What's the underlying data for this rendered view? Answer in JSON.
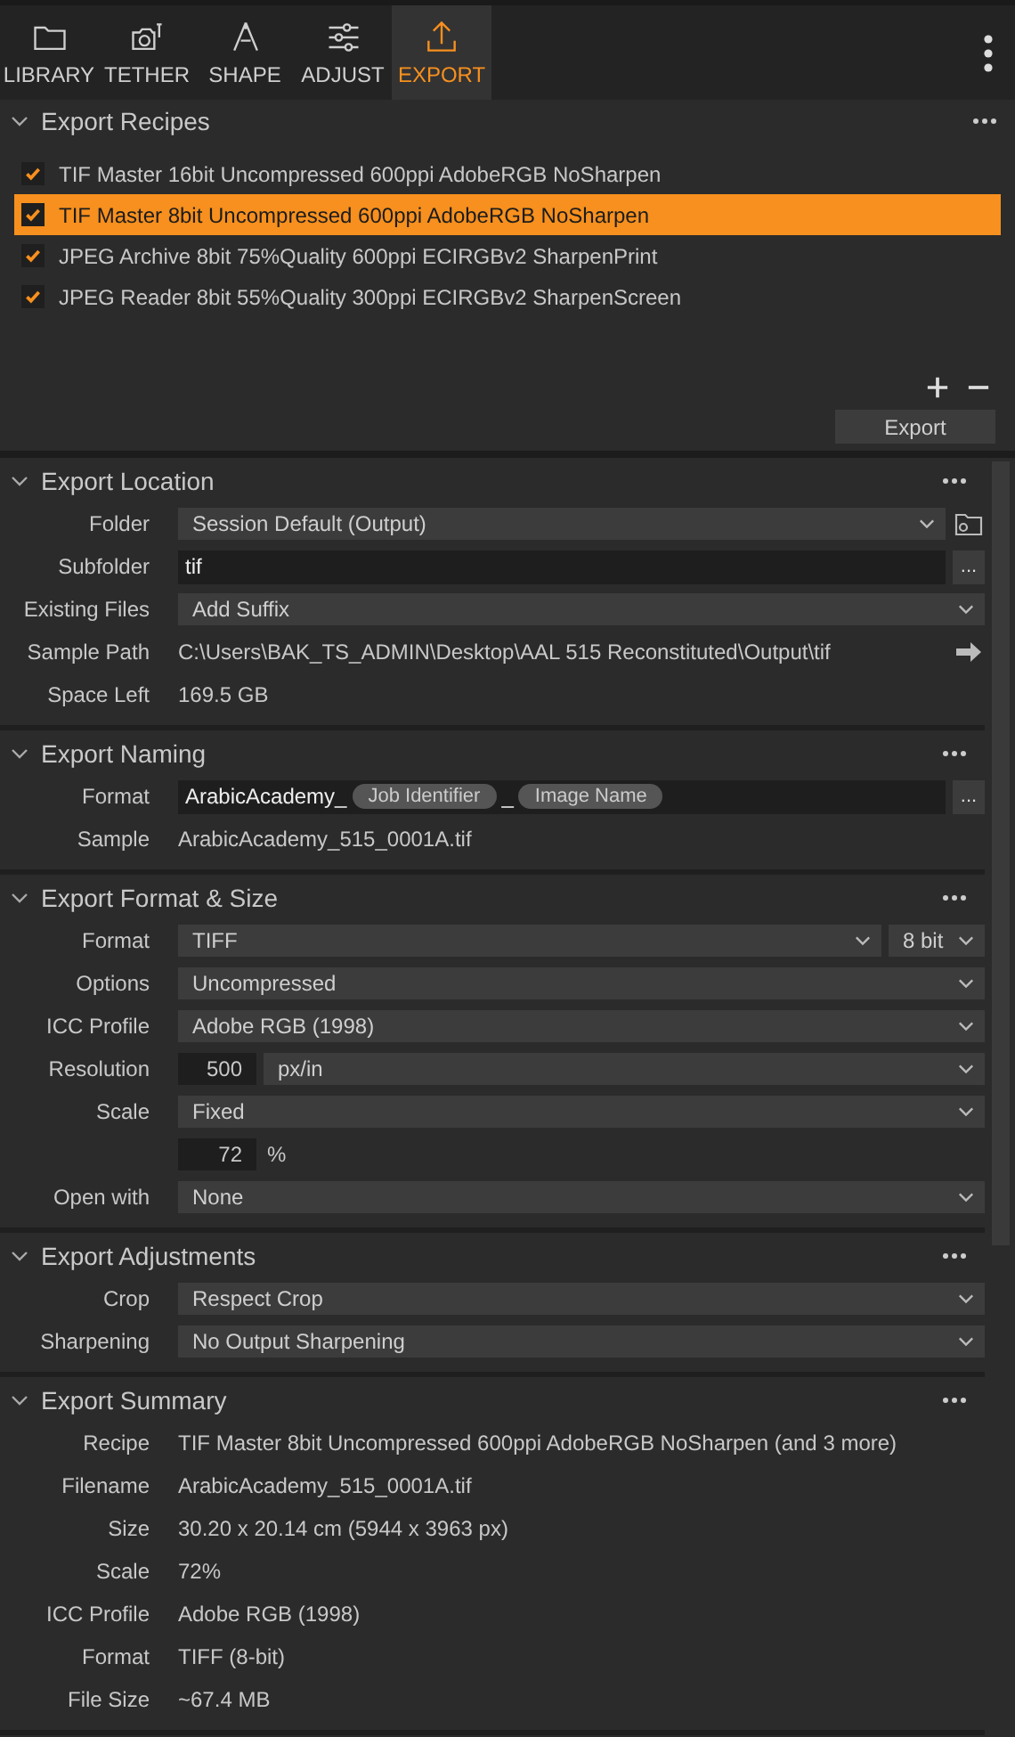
{
  "tabs": [
    {
      "label": "LIBRARY",
      "selected": false
    },
    {
      "label": "TETHER",
      "selected": false
    },
    {
      "label": "SHAPE",
      "selected": false
    },
    {
      "label": "ADJUST",
      "selected": false
    },
    {
      "label": "EXPORT",
      "selected": true
    }
  ],
  "recipes": {
    "title": "Export Recipes",
    "items": [
      {
        "label": "TIF Master 16bit Uncompressed 600ppi AdobeRGB NoSharpen",
        "checked": true,
        "selected": false
      },
      {
        "label": "TIF Master 8bit Uncompressed 600ppi AdobeRGB NoSharpen",
        "checked": true,
        "selected": true
      },
      {
        "label": "JPEG Archive 8bit 75%Quality 600ppi ECIRGBv2 SharpenPrint",
        "checked": true,
        "selected": false
      },
      {
        "label": "JPEG Reader 8bit 55%Quality 300ppi ECIRGBv2 SharpenScreen",
        "checked": true,
        "selected": false
      }
    ],
    "export_button": "Export"
  },
  "sections": [
    {
      "title": "Export Location",
      "rows": [
        {
          "kind": "select-folder",
          "label": "Folder",
          "value": "Session Default (Output)"
        },
        {
          "kind": "input",
          "label": "Subfolder",
          "value": "tif",
          "button": "..."
        },
        {
          "kind": "select",
          "label": "Existing Files",
          "value": "Add Suffix"
        },
        {
          "kind": "text-link",
          "label": "Sample Path",
          "value": "C:\\Users\\BAK_TS_ADMIN\\Desktop\\AAL 515 Reconstituted\\Output\\tif"
        },
        {
          "kind": "text",
          "label": "Space Left",
          "value": "169.5 GB"
        }
      ]
    },
    {
      "title": "Export Naming",
      "rows": [
        {
          "kind": "tokens",
          "label": "Format",
          "parts": [
            {
              "kind": "text",
              "text": "ArabicAcademy_"
            },
            {
              "kind": "token",
              "text": "Job Identifier"
            },
            {
              "kind": "text",
              "text": "_"
            },
            {
              "kind": "token",
              "text": "Image Name"
            }
          ],
          "button": "..."
        },
        {
          "kind": "text",
          "label": "Sample",
          "value": "ArabicAcademy_515_0001A.tif"
        }
      ]
    },
    {
      "title": "Export Format & Size",
      "rows": [
        {
          "kind": "select-pair",
          "label": "Format",
          "value": "TIFF",
          "value2": "8 bit"
        },
        {
          "kind": "select",
          "label": "Options",
          "value": "Uncompressed"
        },
        {
          "kind": "select",
          "label": "ICC Profile",
          "value": "Adobe RGB (1998)"
        },
        {
          "kind": "number-select",
          "label": "Resolution",
          "value": "500",
          "value2": "px/in"
        },
        {
          "kind": "select",
          "label": "Scale",
          "value": "Fixed"
        },
        {
          "kind": "number-unit",
          "value": "72",
          "unit": "%"
        },
        {
          "kind": "select",
          "label": "Open with",
          "value": "None"
        }
      ]
    },
    {
      "title": "Export Adjustments",
      "rows": [
        {
          "kind": "select",
          "label": "Crop",
          "value": "Respect Crop"
        },
        {
          "kind": "select",
          "label": "Sharpening",
          "value": "No Output Sharpening"
        }
      ]
    },
    {
      "title": "Export Summary",
      "rows": [
        {
          "kind": "text",
          "label": "Recipe",
          "value": "TIF Master 8bit Uncompressed 600ppi AdobeRGB NoSharpen  (and 3 more)"
        },
        {
          "kind": "text",
          "label": "Filename",
          "value": "ArabicAcademy_515_0001A.tif"
        },
        {
          "kind": "text",
          "label": "Size",
          "value": "30.20 x 20.14 cm (5944 x 3963 px)"
        },
        {
          "kind": "text",
          "label": "Scale",
          "value": "72%"
        },
        {
          "kind": "text",
          "label": "ICC Profile",
          "value": "Adobe RGB (1998)"
        },
        {
          "kind": "text",
          "label": "Format",
          "value": "TIFF (8-bit)"
        },
        {
          "kind": "text",
          "label": "File Size",
          "value": "~67.4 MB"
        }
      ]
    }
  ]
}
